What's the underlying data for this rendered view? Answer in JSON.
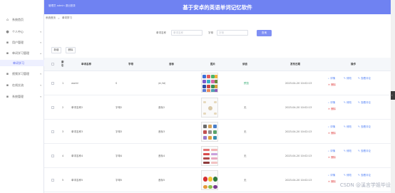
{
  "header": {
    "welcome": "管理员 admin  退出登录",
    "title": "基于安卓的英语单词记忆软件"
  },
  "sidebar": {
    "items": [
      {
        "icon": "home-icon",
        "label": "系统首页"
      },
      {
        "icon": "user-icon",
        "label": "个人中心"
      },
      {
        "icon": "grid-icon",
        "label": "用户管理"
      },
      {
        "icon": "grid-icon",
        "label": "单词学习管理"
      },
      {
        "icon": "grid-icon",
        "label": "视频学习管理"
      },
      {
        "icon": "grid-icon",
        "label": "在线交流"
      },
      {
        "icon": "grid-icon",
        "label": "系统管理"
      }
    ],
    "submenu": {
      "label": "单词学习"
    }
  },
  "breadcrumb": {
    "home": "系统首页",
    "separator": ">",
    "current": "单词学习"
  },
  "search": {
    "field1_label": "单词名称",
    "field1_placeholder": "单词名称",
    "field2_label": "字母",
    "field2_placeholder": "字母",
    "button": "查询"
  },
  "actions": {
    "add": "新增",
    "delete": "删除"
  },
  "table": {
    "columns": [
      "索引",
      "单词名称",
      "字母",
      "音标",
      "图片",
      "读音",
      "发布日期",
      "操作"
    ],
    "rows": [
      {
        "index": "1",
        "word": "world",
        "letter": "S",
        "phonetic": "/d:/ld/",
        "audio": "预览",
        "date": "2023-04-20 10:02:13"
      },
      {
        "index": "2",
        "word": "单词名称2",
        "letter": "字母2",
        "phonetic": "音标2",
        "audio": "无",
        "date": "2023-04-20 10:02:13"
      },
      {
        "index": "3",
        "word": "单词名称3",
        "letter": "字母3",
        "phonetic": "音标3",
        "audio": "无",
        "date": "2023-04-20 10:02:13"
      },
      {
        "index": "4",
        "word": "单词名称4",
        "letter": "字母4",
        "phonetic": "音标4",
        "audio": "无",
        "date": "2023-04-20 10:02:13"
      },
      {
        "index": "5",
        "word": "单词名称5",
        "letter": "字母5",
        "phonetic": "音标5",
        "audio": "无",
        "date": "2023-04-20 10:02:13"
      }
    ],
    "ops": {
      "detail": "详情",
      "edit": "修改",
      "review": "查看评论",
      "delete": "删除"
    }
  },
  "watermark": "CSDN @溪言学姐毕设",
  "colors": {
    "header": "#6f82f2",
    "accent": "#4f7ff5",
    "danger": "#e04747",
    "success": "#2aa76b"
  }
}
